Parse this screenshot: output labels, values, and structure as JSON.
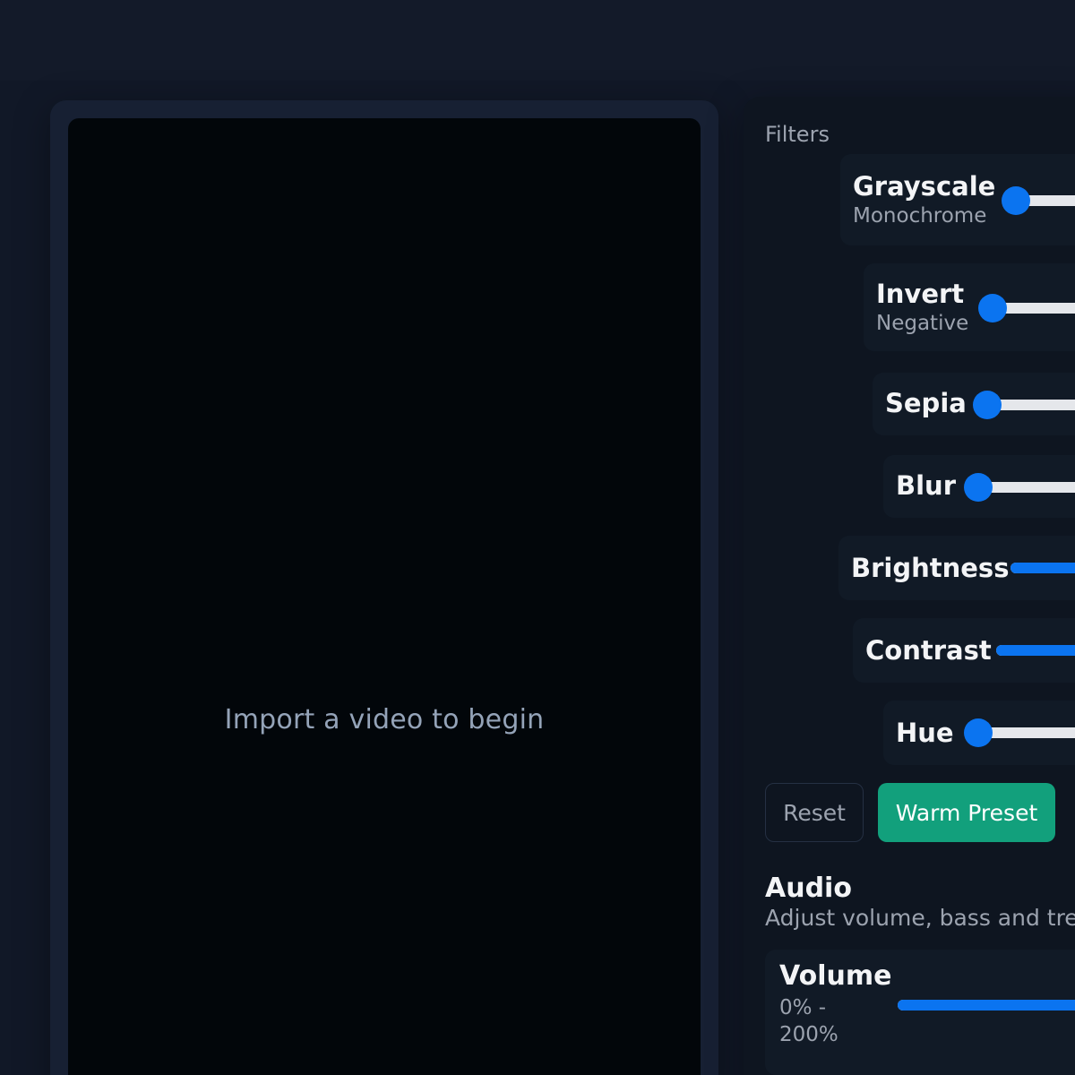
{
  "video": {
    "placeholder": "Import a video to begin"
  },
  "filters": {
    "section_title": "Filters",
    "items": [
      {
        "name": "Grayscale",
        "sub": "Monochrome",
        "value": 0
      },
      {
        "name": "Invert",
        "sub": "Negative",
        "value": 0
      },
      {
        "name": "Sepia",
        "sub": "",
        "value": 0
      },
      {
        "name": "Blur",
        "sub": "",
        "value": 0
      },
      {
        "name": "Brightness",
        "sub": "",
        "value": 1
      },
      {
        "name": "Contrast",
        "sub": "",
        "value": 1
      },
      {
        "name": "Hue",
        "sub": "",
        "value": 0
      }
    ],
    "reset_label": "Reset",
    "warm_preset_label": "Warm Preset"
  },
  "audio": {
    "title": "Audio",
    "description": "Adjust volume, bass and treble",
    "volume": {
      "name": "Volume",
      "range_label": "0% - 200%",
      "value": 1
    }
  },
  "colors": {
    "accent": "#0b74f0",
    "preset": "#12a07c",
    "background": "#111827"
  }
}
